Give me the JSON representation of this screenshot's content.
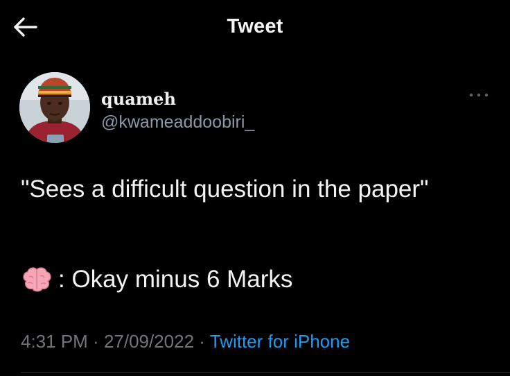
{
  "header": {
    "title": "Tweet",
    "back_icon": "arrow-left-icon"
  },
  "author": {
    "name": "quameh",
    "handle": "@kwameaddoobiri_",
    "more_icon": "more-horizontal-icon"
  },
  "tweet": {
    "text_line1": "\"Sees a difficult question in the paper\"",
    "emoji": "brain-emoji",
    "text_line2": ": Okay minus 6 Marks"
  },
  "meta": {
    "time": "4:31 PM",
    "separator": " · ",
    "date": "27/09/2022",
    "source": "Twitter for iPhone"
  },
  "colors": {
    "background": "#000000",
    "text": "#e7e9ea",
    "muted": "#71767b",
    "link": "#1d9bf0"
  }
}
